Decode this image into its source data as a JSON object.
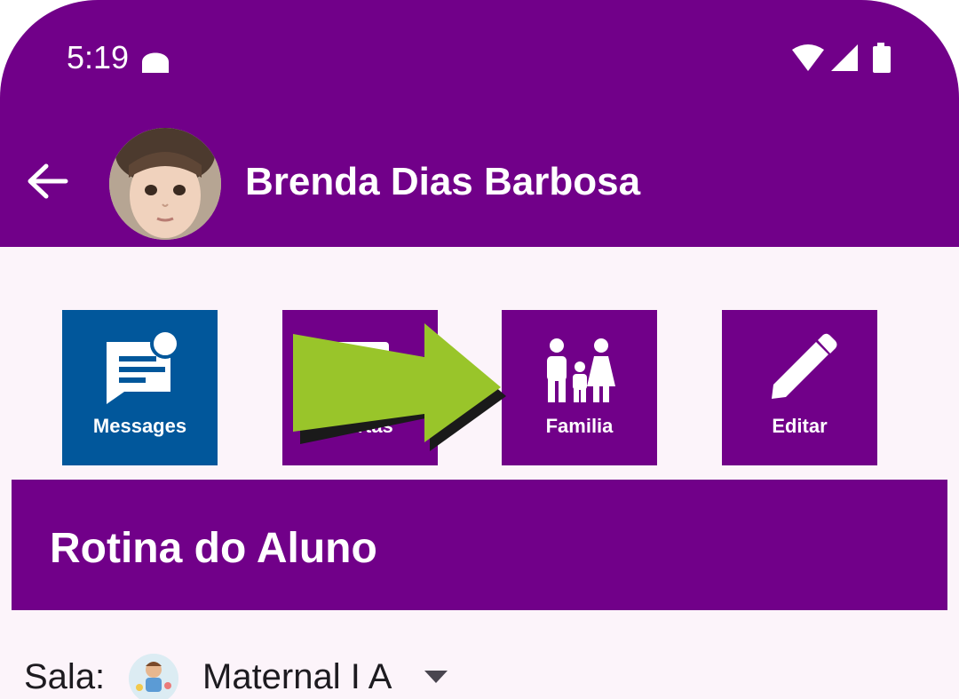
{
  "status_bar": {
    "time": "5:19"
  },
  "app_bar": {
    "student_name": "Brenda Dias Barbosa"
  },
  "tiles": [
    {
      "label": "Messages",
      "icon": "chat-bubble-icon",
      "color": "#01579b"
    },
    {
      "label": "Alertas",
      "icon": "alert-icon",
      "color": "#710089"
    },
    {
      "label": "Familia",
      "icon": "family-icon",
      "color": "#710089"
    },
    {
      "label": "Editar",
      "icon": "pencil-icon",
      "color": "#710089"
    }
  ],
  "section": {
    "title": "Rotina do Aluno"
  },
  "class_selector": {
    "label": "Sala:",
    "value": "Maternal I A"
  },
  "colors": {
    "primary": "#710089",
    "messages_tile": "#01579b",
    "background": "#fcf4fa",
    "annotation_arrow": "#99c52a"
  }
}
